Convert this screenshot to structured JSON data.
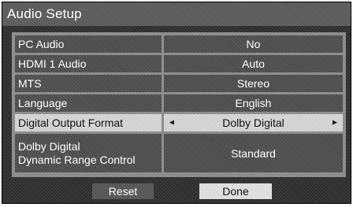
{
  "window": {
    "title": "Audio Setup"
  },
  "settings": [
    {
      "label": "PC Audio",
      "value": "No"
    },
    {
      "label": "HDMI 1 Audio",
      "value": "Auto"
    },
    {
      "label": "MTS",
      "value": "Stereo"
    },
    {
      "label": "Language",
      "value": "English"
    },
    {
      "label": "Digital Output Format",
      "value": "Dolby Digital",
      "selected": true
    },
    {
      "label_line1": "Dolby Digital",
      "label_line2": "Dynamic Range Control",
      "value": "Standard"
    }
  ],
  "arrows": {
    "left": "◄",
    "right": "►"
  },
  "buttons": {
    "reset": "Reset",
    "done": "Done"
  },
  "colors": {
    "selected_bg": "#d8d8d8",
    "row_bg": "#4d4d4d",
    "panel_bg": "#8a8a8a"
  }
}
